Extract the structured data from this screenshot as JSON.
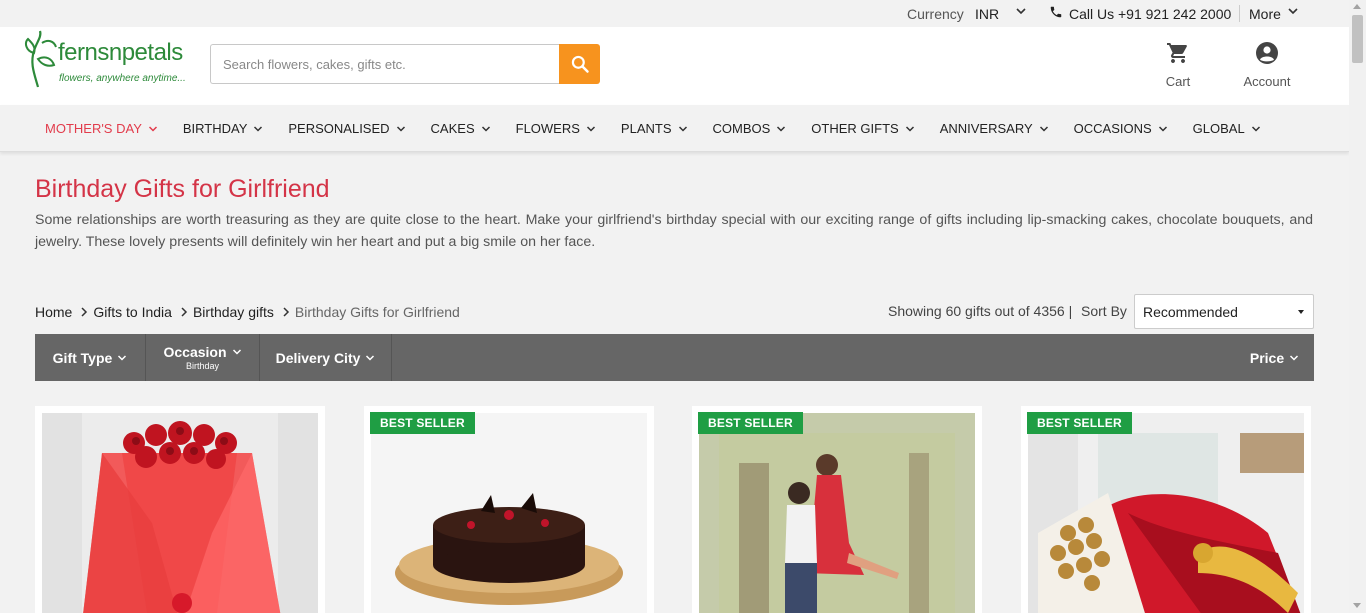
{
  "topbar": {
    "currency_label": "Currency",
    "currency_value": "INR",
    "call_text": "Call Us +91 921 242 2000",
    "more_label": "More"
  },
  "header": {
    "brand_name": "fernsnpetals",
    "tagline": "flowers, anywhere anytime...",
    "search_placeholder": "Search flowers, cakes, gifts etc.",
    "cart_label": "Cart",
    "account_label": "Account",
    "accent_color": "#f7931e",
    "brand_color": "#2d8a3a"
  },
  "nav": {
    "items": [
      {
        "label": "MOTHER'S DAY",
        "active": true
      },
      {
        "label": "BIRTHDAY"
      },
      {
        "label": "PERSONALISED"
      },
      {
        "label": "CAKES"
      },
      {
        "label": "FLOWERS"
      },
      {
        "label": "PLANTS"
      },
      {
        "label": "COMBOS"
      },
      {
        "label": "OTHER GIFTS"
      },
      {
        "label": "ANNIVERSARY"
      },
      {
        "label": "OCCASIONS"
      },
      {
        "label": "GLOBAL"
      }
    ],
    "active_color": "#e23c4c"
  },
  "main": {
    "title": "Birthday Gifts for Girlfriend",
    "description": "Some relationships are worth treasuring as they are quite close to the heart. Make your girlfriend's birthday special with our exciting range of gifts including lip-smacking cakes, chocolate bouquets, and jewelry. These lovely presents will definitely win her heart and put a big smile on her face."
  },
  "breadcrumb": [
    "Home",
    "Gifts to India",
    "Birthday gifts",
    "Birthday Gifts for Girlfriend"
  ],
  "listing": {
    "showing_text": "Showing 60 gifts out of 4356 |",
    "sort_label": "Sort By",
    "sort_value": "Recommended"
  },
  "filters": {
    "gift_type": "Gift Type",
    "occasion": "Occasion",
    "occasion_selected": "Birthday",
    "delivery_city": "Delivery City",
    "price": "Price"
  },
  "products": [
    {
      "badge": "",
      "image": "red-roses-bouquet"
    },
    {
      "badge": "BEST SELLER",
      "image": "chocolate-truffle-cake"
    },
    {
      "badge": "BEST SELLER",
      "image": "personalised-photo-cushion"
    },
    {
      "badge": "BEST SELLER",
      "image": "ferrero-rocher-roses-bouquet"
    }
  ],
  "badge_color": "#1f9e44"
}
